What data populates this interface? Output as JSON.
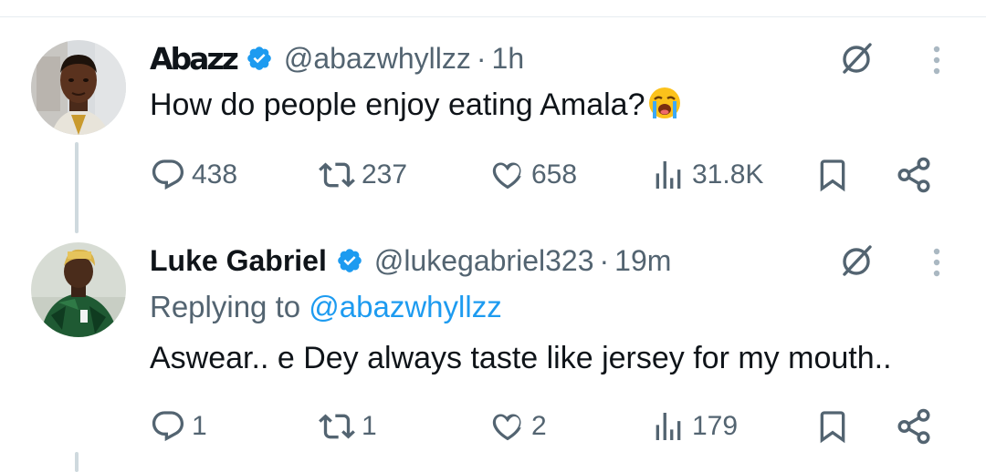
{
  "tweets": [
    {
      "display_name": "Abazz",
      "handle": "@abazwhyllzz",
      "separator": "·",
      "time": "1h",
      "text": "How do people enjoy eating Amala?",
      "emoji": "😭",
      "replies": "438",
      "reposts": "237",
      "likes": "658",
      "views": "31.8K"
    },
    {
      "display_name": "Luke Gabriel",
      "handle": "@lukegabriel323",
      "separator": "·",
      "time": "19m",
      "replying_prefix": "Replying to",
      "replying_to": "@abazwhyllzz",
      "text": "Aswear.. e Dey always taste like jersey for my mouth..",
      "replies": "1",
      "reposts": "1",
      "likes": "2",
      "views": "179"
    }
  ],
  "colors": {
    "accent": "#1d9bf0",
    "muted": "#536471",
    "text": "#0f1419",
    "verified": "#1d9bf0"
  },
  "icons": [
    "verified-badge-icon",
    "grok-icon",
    "more-icon",
    "reply-icon",
    "repost-icon",
    "like-icon",
    "views-icon",
    "bookmark-icon",
    "share-icon",
    "loudly-crying-face-emoji"
  ]
}
